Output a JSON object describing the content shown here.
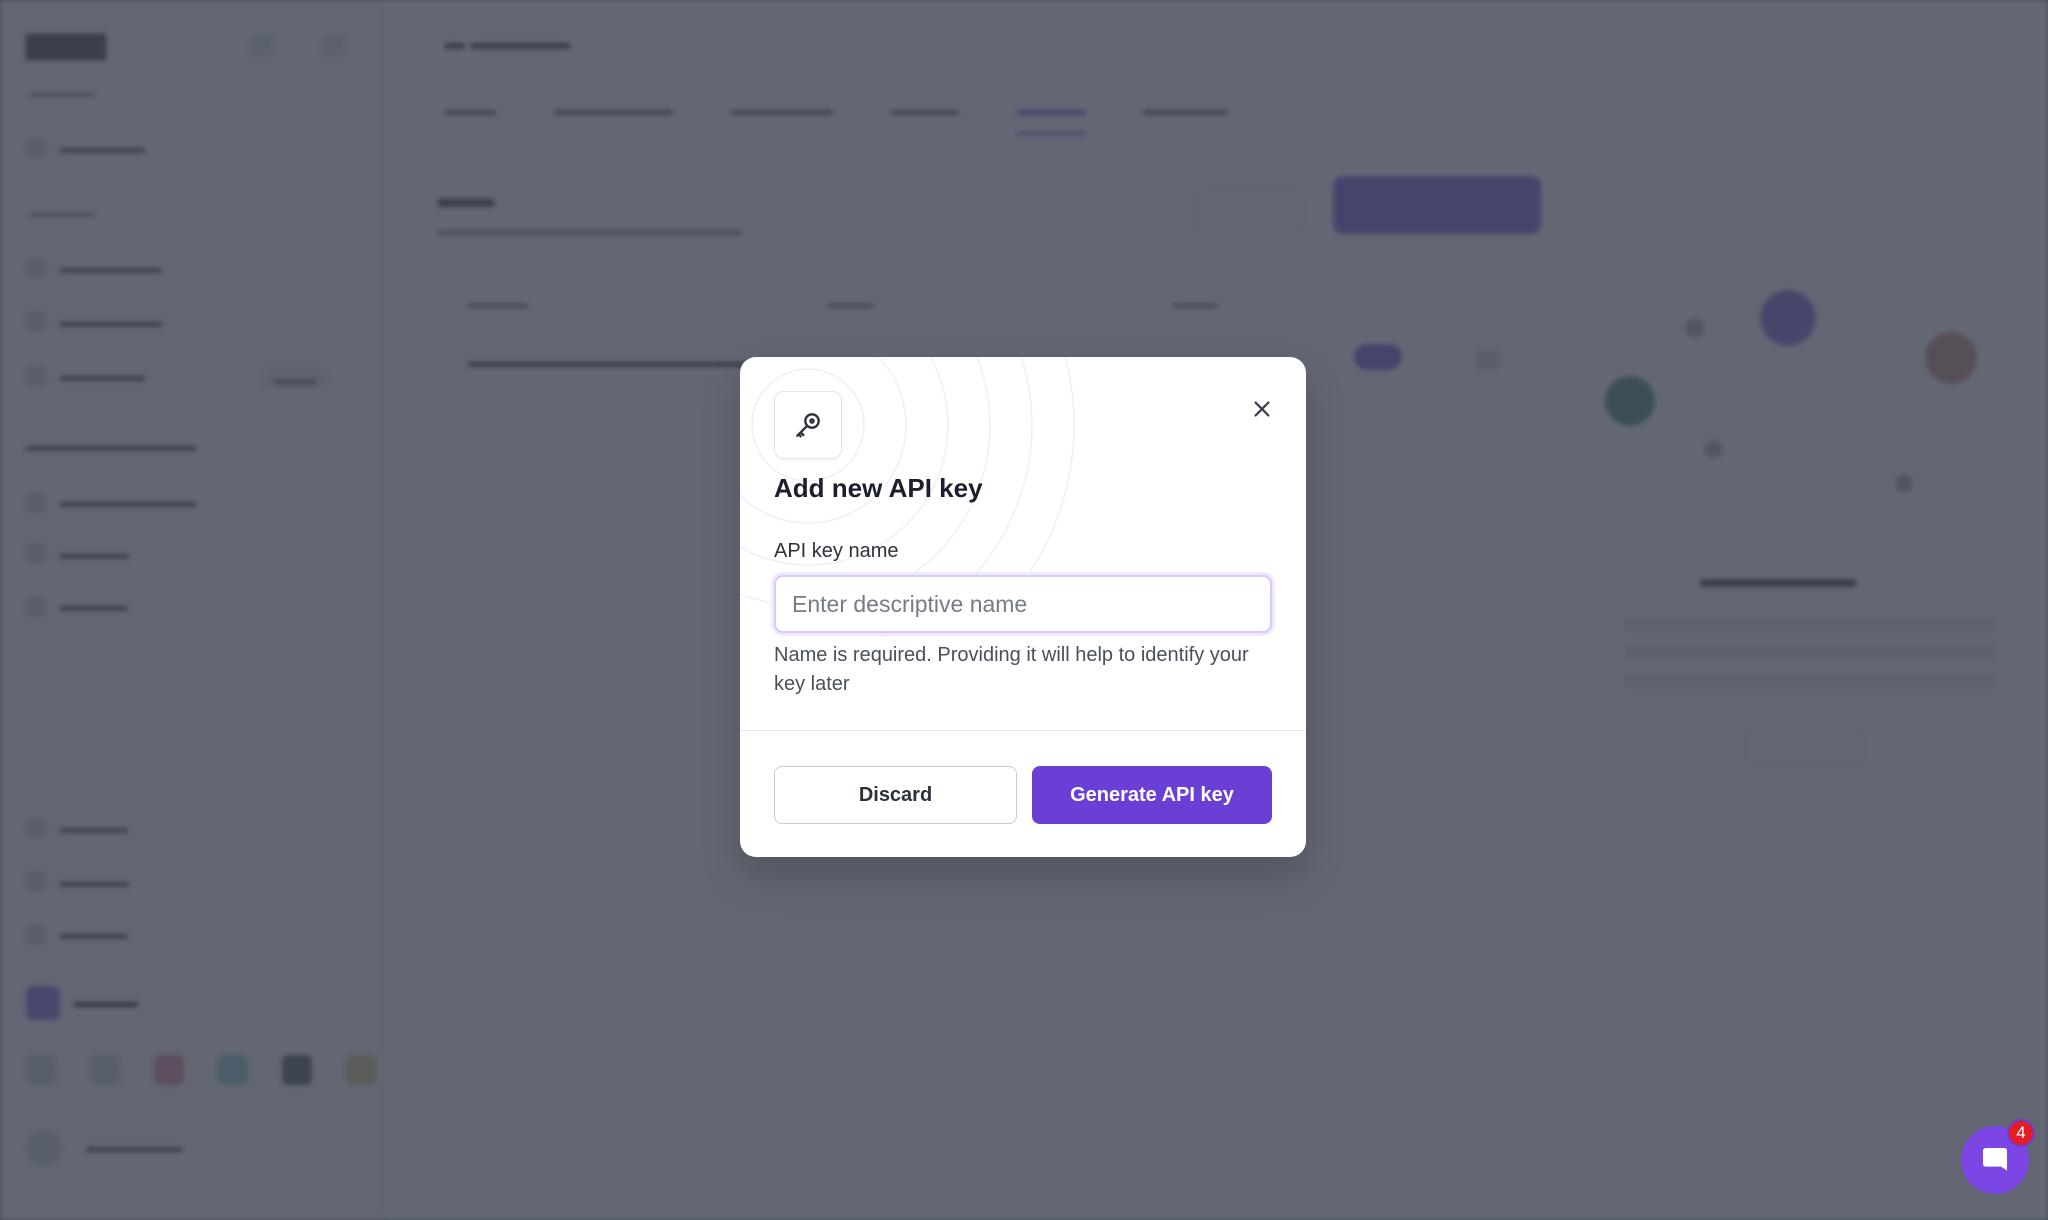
{
  "modal": {
    "title": "Add new API key",
    "icon": "key-icon",
    "field_label": "API key name",
    "field_placeholder": "Enter descriptive name",
    "field_value": "",
    "hint": "Name is required. Providing it will help to identify your key later",
    "discard_label": "Discard",
    "generate_label": "Generate API key"
  },
  "chat_widget": {
    "icon": "chat-icon",
    "badge_count": "4"
  },
  "colors": {
    "accent": "#6a3fd6",
    "overlay": "#404654",
    "badge": "#e51c23"
  }
}
